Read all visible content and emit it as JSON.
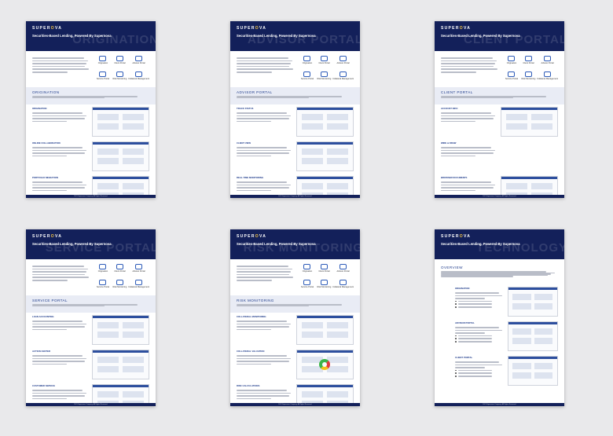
{
  "brand": {
    "logo_prefix": "SUPER",
    "logo_o": "O",
    "logo_suffix": "VA",
    "tagline": "Securities-Based Lending, Powered By Supernova"
  },
  "pages": [
    {
      "id": "origination",
      "watermark": "ORIGINATION",
      "section_title": "ORIGINATION",
      "icons": [
        "Origination",
        "Client Portal",
        "Advisor Portal",
        "Service Portal",
        "Risk Monitoring",
        "Collateral Management"
      ],
      "rows": [
        "ORIGINATION",
        "ONLINE COLLABORATION",
        "PORTFOLIO MIGRATION"
      ]
    },
    {
      "id": "advisor",
      "watermark": "ADVISOR PORTAL",
      "section_title": "ADVISOR PORTAL",
      "icons": [
        "Origination",
        "Client Portal",
        "Advisor Portal",
        "Service Portal",
        "Risk Monitoring",
        "Collateral Management"
      ],
      "rows": [
        "TRACK STATUS",
        "CLIENT VIEW",
        "REAL-TIME MONITORING"
      ]
    },
    {
      "id": "client",
      "watermark": "CLIENT PORTAL",
      "section_title": "CLIENT PORTAL",
      "icons": [
        "Origination",
        "Client Portal",
        "Advisor Portal",
        "Service Portal",
        "Risk Monitoring",
        "Collateral Management"
      ],
      "rows": [
        "ACCOUNT INFO",
        "WIRE & DRAW",
        "BROWSER DOCUMENTS"
      ]
    },
    {
      "id": "service",
      "watermark": "SERVICE PORTAL",
      "section_title": "SERVICE PORTAL",
      "icons": [
        "Origination",
        "Client Portal",
        "Advisor Portal",
        "Service Portal",
        "Risk Monitoring",
        "Collateral Management"
      ],
      "rows": [
        "LOAN ACCOUNTING",
        "ACTION CENTER",
        "CUSTOMER SERVICE"
      ]
    },
    {
      "id": "risk",
      "watermark": "RISK MONITORING",
      "section_title": "RISK MONITORING",
      "icons": [
        "Origination",
        "Client Portal",
        "Advisor Portal",
        "Service Portal",
        "Risk Monitoring",
        "Collateral Management"
      ],
      "rows": [
        "COLLATERAL MONITORING",
        "COLLATERAL VALUATION",
        "RISK CALCULATIONS"
      ]
    },
    {
      "id": "technology",
      "watermark": "TECHNOLOGY",
      "section_title": "OVERVIEW",
      "rows": [
        "ORIGINATION",
        "ADVISOR PORTAL",
        "CLIENT PORTAL"
      ]
    }
  ],
  "footer": "2021 Supernova Company. All Rights Reserved."
}
